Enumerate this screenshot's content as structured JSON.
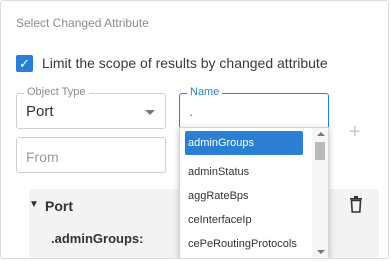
{
  "section": {
    "title": "Select Changed Attribute",
    "checkbox_label": "Limit the scope of results by changed attribute",
    "checkbox_checked": true
  },
  "object_type": {
    "legend": "Object Type",
    "value": "Port"
  },
  "name_field": {
    "legend": "Name",
    "value": "."
  },
  "from_field": {
    "placeholder": "From"
  },
  "dropdown": {
    "items": [
      {
        "label": "adminGroups",
        "active": true
      },
      {
        "label": "adminStatus"
      },
      {
        "label": "aggRateBps"
      },
      {
        "label": "ceInterfaceIp"
      },
      {
        "label": "cePeRoutingProtocols"
      }
    ]
  },
  "group": {
    "toggle": "▼",
    "name": "Port",
    "attribute": ".adminGroups:"
  },
  "colors": {
    "accent": "#2a7fd4"
  },
  "icons": {
    "add": "plus-icon",
    "delete": "trash-icon"
  }
}
